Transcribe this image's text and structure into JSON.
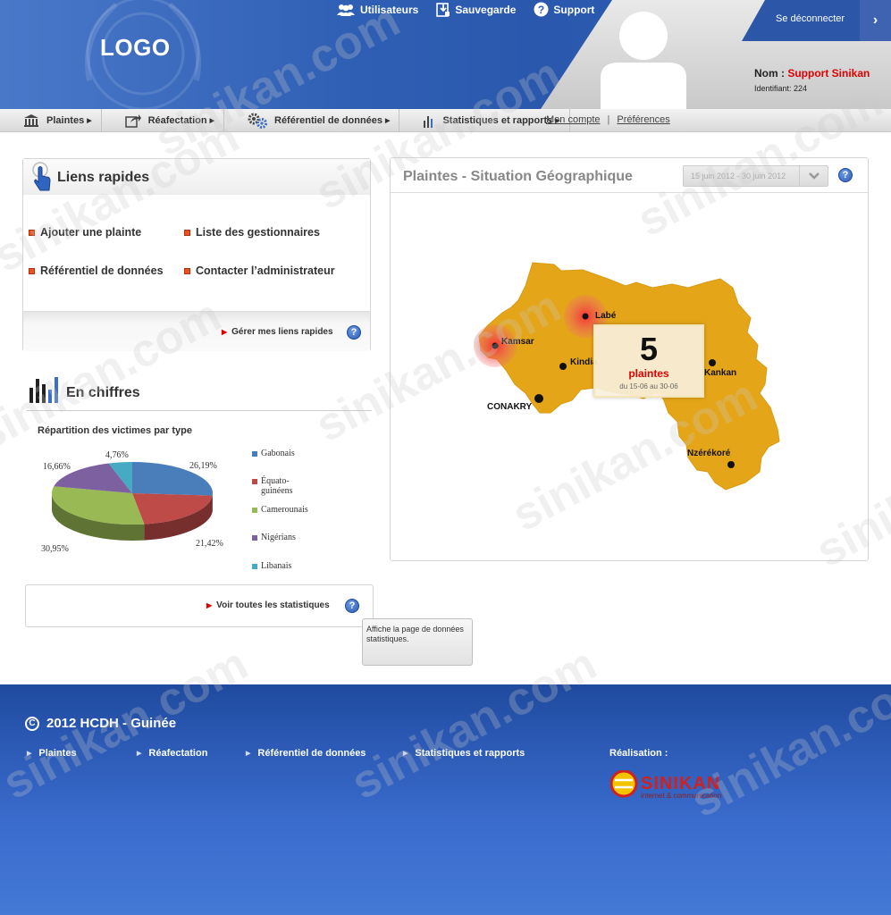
{
  "header": {
    "logo": "LOGO",
    "top_links": [
      {
        "label": "Utilisateurs",
        "icon": "users-icon"
      },
      {
        "label": "Sauvegarde",
        "icon": "save-icon"
      },
      {
        "label": "Support",
        "icon": "help-icon"
      }
    ],
    "logout": "Se déconnecter",
    "user": {
      "name_label": "Nom :",
      "name_value": "Support Sinikan",
      "id_label": "Identifiant: 224"
    }
  },
  "nav": {
    "items": [
      {
        "label": "Plaintes",
        "icon": "building-icon"
      },
      {
        "label": "Réafectation",
        "icon": "share-icon"
      },
      {
        "label": "Référentiel de données",
        "icon": "gears-icon"
      },
      {
        "label": "Statistiques et rapports",
        "icon": "bar-chart-icon"
      }
    ],
    "secondary": [
      "Mon compte",
      "Préférences"
    ],
    "separator": "|"
  },
  "quick_links": {
    "title": "Liens rapides",
    "links": [
      "Ajouter une plainte",
      "Liste des gestionnaires",
      "Référentiel de données",
      "Contacter l’administrateur"
    ],
    "manage": "Gérer mes liens rapides"
  },
  "figures": {
    "title": "En chiffres",
    "stats_link": "Voir toutes les statistiques",
    "tooltip": "Affiche la page de données statistiques."
  },
  "chart_data": {
    "type": "pie",
    "title": "Répartition des victimes par type",
    "labels": [
      "Gabonais",
      "Équato-guinéens",
      "Camerounais",
      "Nigérians",
      "Libanais"
    ],
    "values": [
      26.19,
      21.42,
      30.95,
      16.66,
      4.76
    ],
    "value_labels": [
      "26,19%",
      "21,42%",
      "30,95%",
      "16,66%",
      "4,76%"
    ],
    "colors": [
      "#4a7ebb",
      "#be4b48",
      "#98b954",
      "#7d60a0",
      "#46aac4"
    ],
    "legend_position": "right"
  },
  "map": {
    "title": "Plaintes - Situation Géographique",
    "date_range": "15 juin 2012 - 30 juin 2012",
    "cities": [
      "Labé",
      "Kamsar",
      "Kindia",
      "Kankan",
      "CONAKRY",
      "Nzérékoré"
    ],
    "popup": {
      "count": "5",
      "label": "plaintes",
      "dates": "du 15-06 au 30-06"
    }
  },
  "footer": {
    "copyright": "2012 HCDH - Guinée",
    "links": [
      "Plaintes",
      "Réafectation",
      "Référentiel de données",
      "Statistiques et rapports"
    ],
    "realisation": "Réalisation :",
    "brand": "SINIKAN",
    "brand_tagline": "internet & communication"
  },
  "watermark": "sinikan.com"
}
